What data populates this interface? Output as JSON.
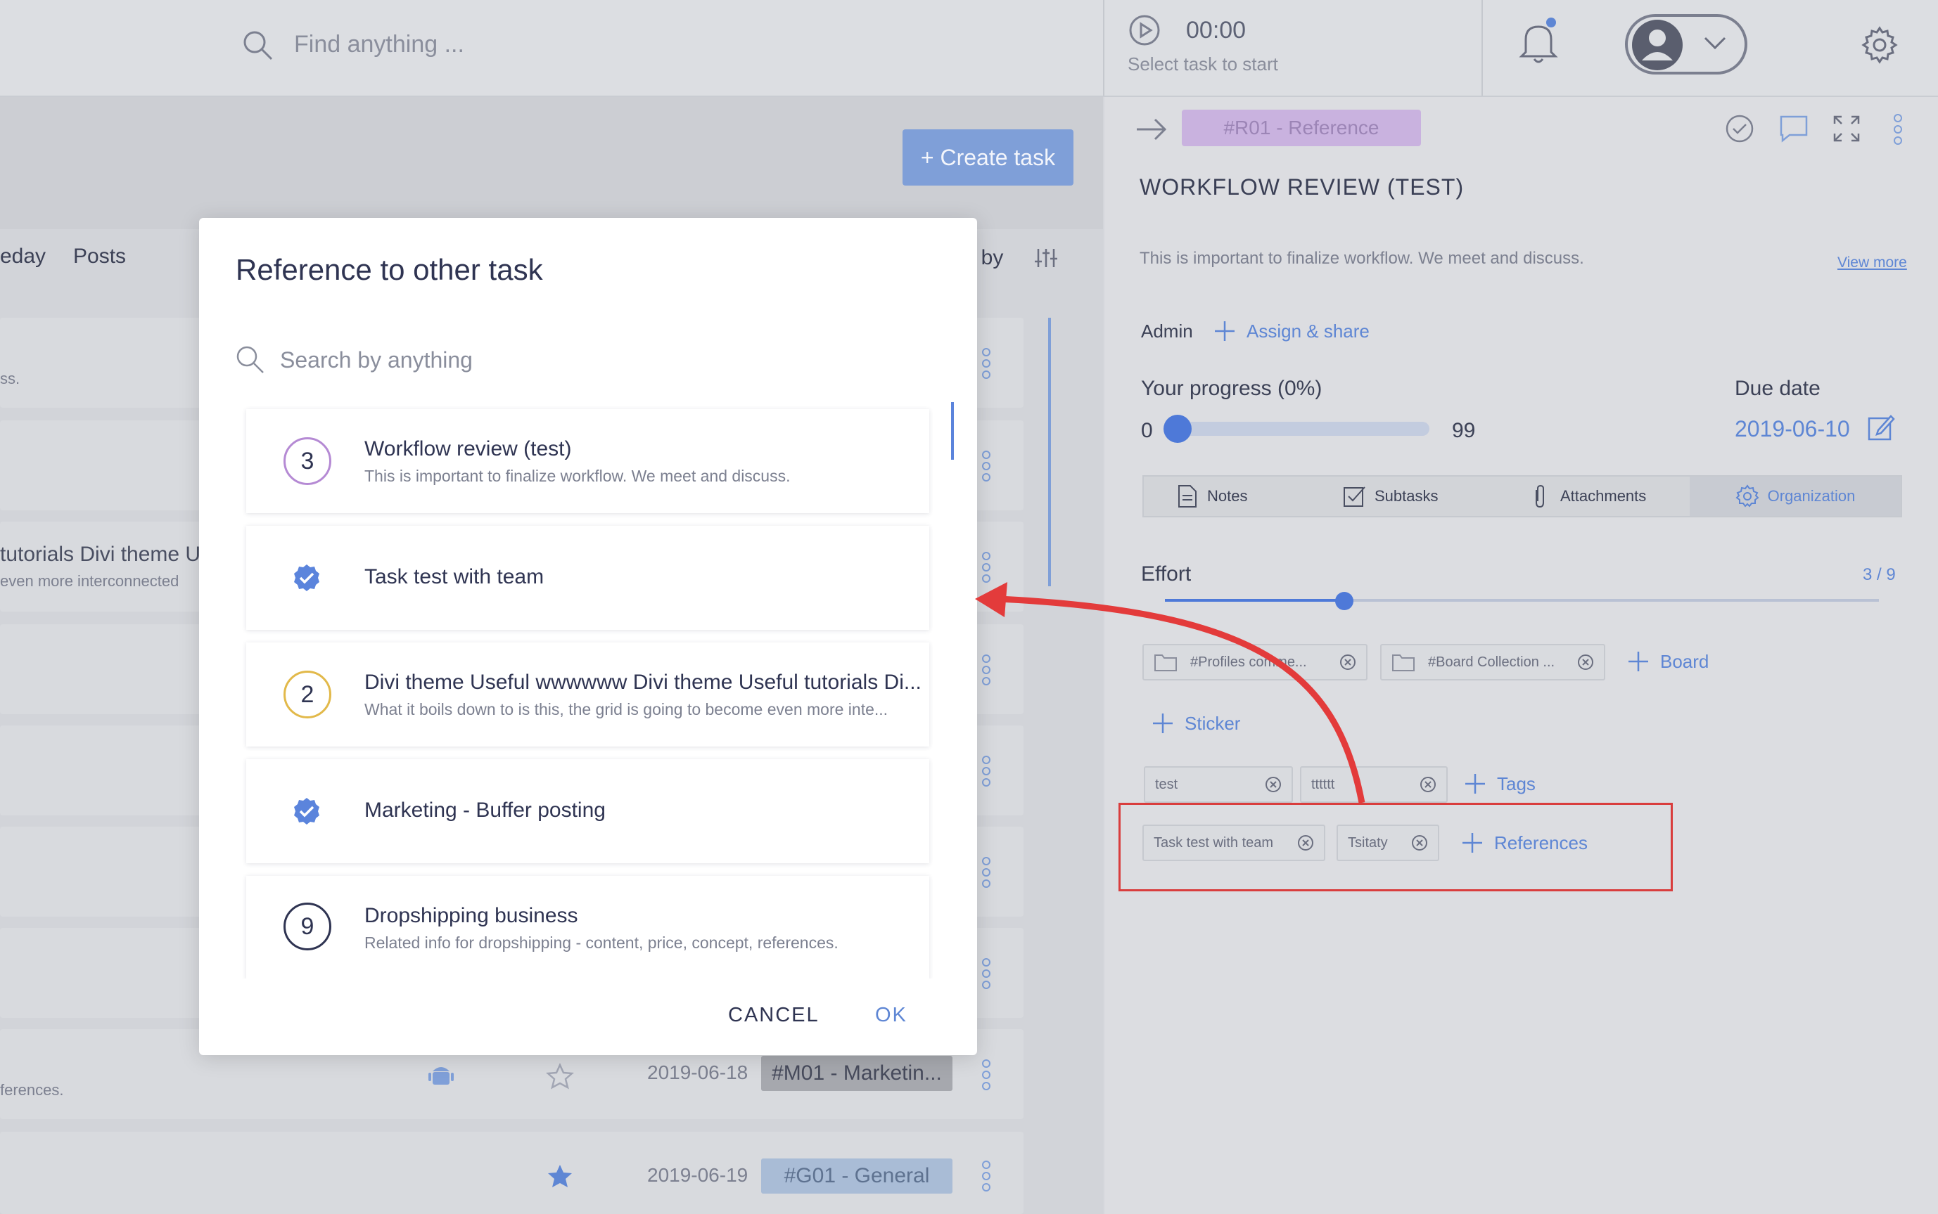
{
  "topbar": {
    "search_placeholder": "Find anything ...",
    "timer_time": "00:00",
    "timer_hint": "Select task to start"
  },
  "left": {
    "create_task": "+ Create task",
    "tabs": [
      "eday",
      "Posts"
    ],
    "sort_by": "rt by",
    "rows": [
      {
        "sub": "ss."
      },
      {
        "title": "tutorials Divi theme U",
        "sub": "even more interconnected"
      },
      {
        "sub": "ferences.",
        "date": "2019-06-18",
        "tag": "#M01 - Marketin..."
      },
      {
        "date": "2019-06-19",
        "tag": "#G01 - General"
      }
    ]
  },
  "panel": {
    "reference_badge": "#R01 - Reference",
    "title": "WORKFLOW REVIEW (TEST)",
    "description": "This is important to finalize workflow. We meet and discuss.",
    "view_more": "View more",
    "admin": "Admin",
    "assign_share": "Assign & share",
    "progress_label": "Your progress  (0%)",
    "progress_min": "0",
    "progress_max": "99",
    "progress_value": 0,
    "due_label": "Due date",
    "due_value": "2019-06-10",
    "tabs": {
      "notes": "Notes",
      "subtasks": "Subtasks",
      "attachments": "Attachments",
      "organization": "Organization"
    },
    "effort_label": "Effort",
    "effort_value": "3 / 9",
    "boards": [
      "#Profiles comme...",
      "#Board Collection ..."
    ],
    "board_add": "Board",
    "sticker_add": "Sticker",
    "tags": [
      "test",
      "tttttt"
    ],
    "tags_add": "Tags",
    "references": [
      "Task test with team",
      "Tsitaty"
    ],
    "references_add": "References"
  },
  "modal": {
    "title": "Reference to other task",
    "search_placeholder": "Search by anything",
    "tasks": [
      {
        "num": "3",
        "title": "Workflow review (test)",
        "sub": "This is important to finalize workflow. We meet and discuss."
      },
      {
        "title": "Task test with team"
      },
      {
        "num": "2",
        "title": "Divi theme Useful wwwwww Divi theme Useful tutorials Di...",
        "sub": "What it boils down to is this, the grid is going to become even more inte..."
      },
      {
        "title": "Marketing - Buffer posting"
      },
      {
        "num": "9",
        "title": "Dropshipping business",
        "sub": "Related info for dropshipping - content, price, concept, references."
      }
    ],
    "cancel": "CANCEL",
    "ok": "OK"
  },
  "colors": {
    "accent": "#5e86d4",
    "highlight": "#d93d3d",
    "circle_purple": "#b58ad4",
    "circle_gold": "#e2b94a",
    "circle_dark": "#2f3452"
  }
}
